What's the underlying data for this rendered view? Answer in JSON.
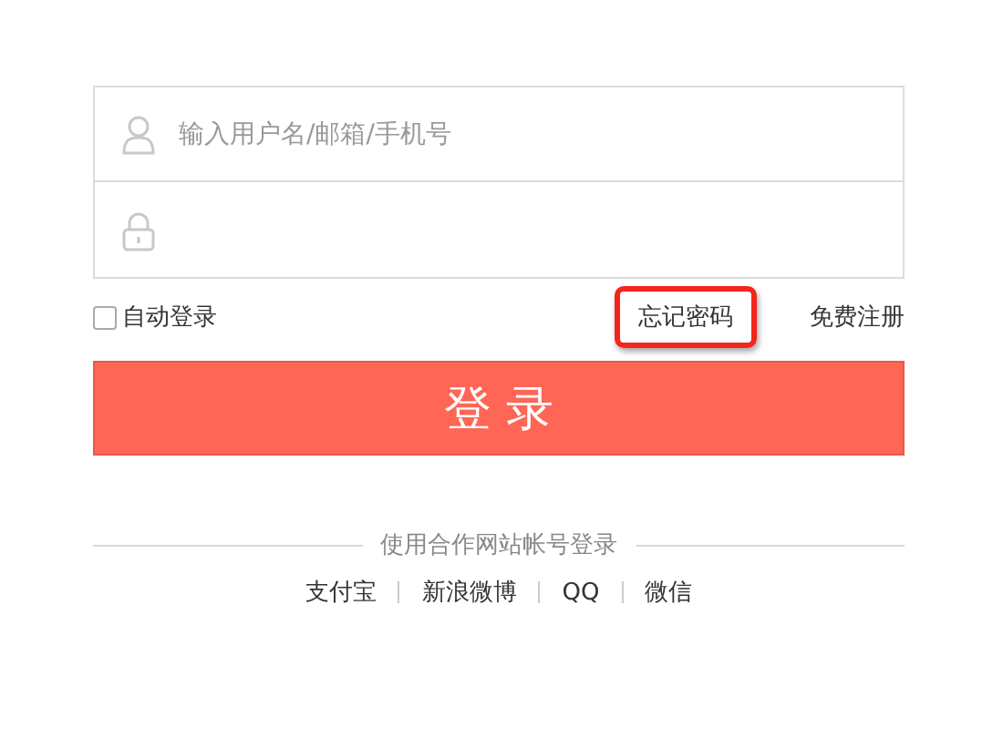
{
  "fields": [
    {
      "kind": "user",
      "placeholder": "输入用户名/邮箱/手机号"
    },
    {
      "kind": "password"
    }
  ],
  "remember": {
    "label": "自动登录",
    "checked": false
  },
  "links": [
    {
      "label": "忘记密码",
      "highlighted": true
    },
    {
      "label": "免费注册",
      "highlighted": false
    }
  ],
  "submit": "登 录",
  "partner": {
    "title": "使用合作网站帐号登录",
    "items": [
      "支付宝",
      "新浪微博",
      "QQ",
      "微信"
    ]
  }
}
